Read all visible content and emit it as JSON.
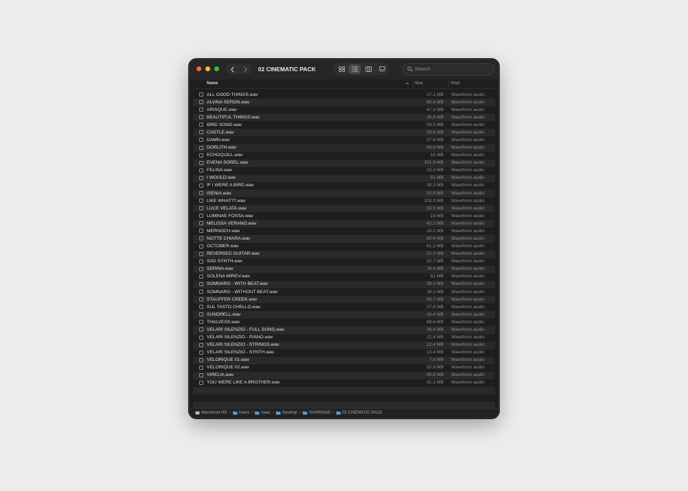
{
  "window": {
    "title": "02 CINEMATIC PACK",
    "active_view": "list"
  },
  "toolbar": {
    "back_icon": "chevron-left-icon",
    "forward_icon": "chevron-right-icon",
    "view_icons": [
      "grid-icon",
      "list-icon",
      "columns-icon",
      "gallery-icon"
    ]
  },
  "search": {
    "placeholder": "Search",
    "value": ""
  },
  "columns": {
    "name": "Name",
    "size": "Size",
    "kind": "Kind",
    "sort_column": "name",
    "sort_direction": "ascending"
  },
  "files": [
    {
      "name": "ALL GOOD THINGS.wav",
      "size": "17.1 MB",
      "kind": "Waveform audio"
    },
    {
      "name": "ALVINA SERON.wav",
      "size": "80.4 MB",
      "kind": "Waveform audio"
    },
    {
      "name": "ARISQUE.wav",
      "size": "47.3 MB",
      "kind": "Waveform audio"
    },
    {
      "name": "BEAUTIFUL THINGS.wav",
      "size": "26.6 MB",
      "kind": "Waveform audio"
    },
    {
      "name": "BIRD SONG.wav",
      "size": "59.5 MB",
      "kind": "Waveform audio"
    },
    {
      "name": "CASTLE.wav",
      "size": "33.6 MB",
      "kind": "Waveform audio"
    },
    {
      "name": "DAMN.wav",
      "size": "37.6 MB",
      "kind": "Waveform audio"
    },
    {
      "name": "DORLITH.wav",
      "size": "49.6 MB",
      "kind": "Waveform audio"
    },
    {
      "name": "ECHOQUILL.wav",
      "size": "16 MB",
      "kind": "Waveform audio"
    },
    {
      "name": "EVENA SOREL.wav",
      "size": "101.9 MB",
      "kind": "Waveform audio"
    },
    {
      "name": "FELINA.wav",
      "size": "23.3 MB",
      "kind": "Waveform audio"
    },
    {
      "name": "I WOULD.wav",
      "size": "51 MB",
      "kind": "Waveform audio"
    },
    {
      "name": "IF I WERE A BIRD.wav",
      "size": "38.3 MB",
      "kind": "Waveform audio"
    },
    {
      "name": "ISENIA.wav",
      "size": "20.8 MB",
      "kind": "Waveform audio"
    },
    {
      "name": "LIKE WHAT??.wav",
      "size": "103.3 MB",
      "kind": "Waveform audio"
    },
    {
      "name": "LUCE VELATA.wav",
      "size": "59.5 MB",
      "kind": "Waveform audio"
    },
    {
      "name": "LUMINAE FOSSA.wav",
      "size": "16 MB",
      "kind": "Waveform audio"
    },
    {
      "name": "MELISSA VERANO.wav",
      "size": "42.2 MB",
      "kind": "Waveform audio"
    },
    {
      "name": "MERNOCH.wav",
      "size": "18.2 MB",
      "kind": "Waveform audio"
    },
    {
      "name": "NOTTE CHIARA.wav",
      "size": "60.6 MB",
      "kind": "Waveform audio"
    },
    {
      "name": "OCTOBER.wav",
      "size": "61.2 MB",
      "kind": "Waveform audio"
    },
    {
      "name": "REVERSED GUITAR.wav",
      "size": "21.3 MB",
      "kind": "Waveform audio"
    },
    {
      "name": "SAD SYNTH.wav",
      "size": "52.7 MB",
      "kind": "Waveform audio"
    },
    {
      "name": "SERINA.wav",
      "size": "76.4 MB",
      "kind": "Waveform audio"
    },
    {
      "name": "SOLENA MIREV.wav",
      "size": "51 MB",
      "kind": "Waveform audio"
    },
    {
      "name": "SOMNARO - WITH BEAT.wav",
      "size": "38.3 MB",
      "kind": "Waveform audio"
    },
    {
      "name": "SOMNARO - WITHOUT BEAT.wav",
      "size": "38.3 MB",
      "kind": "Waveform audio"
    },
    {
      "name": "STAUFFER CREEK.wav",
      "size": "63.7 MB",
      "kind": "Waveform audio"
    },
    {
      "name": "SUL TASTO CHELLO.wav",
      "size": "27.6 MB",
      "kind": "Waveform audio"
    },
    {
      "name": "SUNDRELL.wav",
      "size": "16.4 MB",
      "kind": "Waveform audio"
    },
    {
      "name": "THALVESS.wav",
      "size": "68.6 MB",
      "kind": "Waveform audio"
    },
    {
      "name": "VELARI SILENZIO - FULL SONG.wav",
      "size": "26.6 MB",
      "kind": "Waveform audio"
    },
    {
      "name": "VELARI SILENZIO - PIANO.wav",
      "size": "22.4 MB",
      "kind": "Waveform audio"
    },
    {
      "name": "VELARI SILENZIO - STRINGS.wav",
      "size": "22.4 MB",
      "kind": "Waveform audio"
    },
    {
      "name": "VELARI SILENZIO - SYNTH.wav",
      "size": "13.4 MB",
      "kind": "Waveform audio"
    },
    {
      "name": "VELORIQUE 01.wav",
      "size": "7.8 MB",
      "kind": "Waveform audio"
    },
    {
      "name": "VELORIQUE 02.wav",
      "size": "32.8 MB",
      "kind": "Waveform audio"
    },
    {
      "name": "VIRELIA.wav",
      "size": "45.9 MB",
      "kind": "Waveform audio"
    },
    {
      "name": "YOU WERE LIKE A BROTHER.wav",
      "size": "31.1 MB",
      "kind": "Waveform audio"
    }
  ],
  "path_bar": [
    {
      "label": "Macintosh HD",
      "icon": "drive-icon"
    },
    {
      "label": "Users",
      "icon": "folder-icon"
    },
    {
      "label": "isaac",
      "icon": "folder-icon"
    },
    {
      "label": "Desktop",
      "icon": "folder-icon"
    },
    {
      "label": "GUMROAD",
      "icon": "folder-icon"
    },
    {
      "label": "02 CINEMATIC PACK",
      "icon": "folder-icon"
    }
  ],
  "colors": {
    "window_bg": "#1e1e1e",
    "row_alt": "#2a2a2a",
    "text_primary": "#e2e2e2",
    "text_secondary": "#8f8f8f",
    "folder_blue": "#5aa0dd",
    "close": "#fe5f57",
    "minimize": "#febc2e",
    "maximize": "#28c840"
  }
}
